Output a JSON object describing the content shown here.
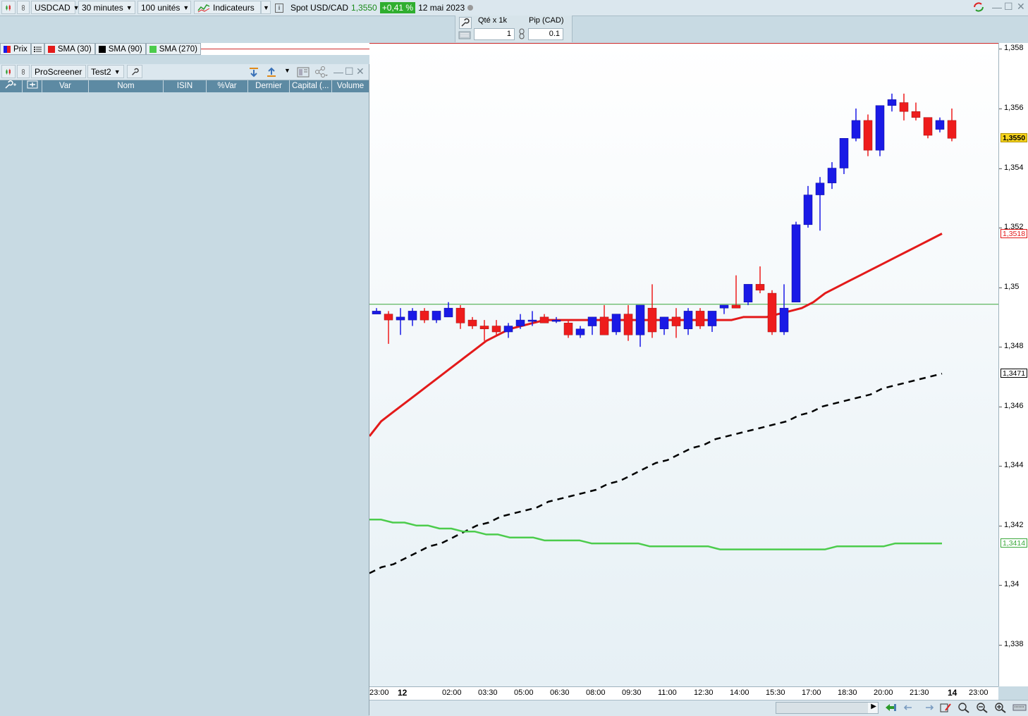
{
  "toolbar": {
    "symbol": "USDCAD",
    "timeframe": "30 minutes",
    "units": "100 unités",
    "indicators_label": "Indicateurs",
    "instrument": "Spot USD/CAD",
    "price": "1,3550",
    "change": "+0,41 %",
    "date": "12 mai 2023"
  },
  "order_panel": {
    "qty_label": "Qté x 1k",
    "pip_label": "Pip (CAD)",
    "qty_value": "1",
    "pip_value": "0.1"
  },
  "legend": {
    "price": "Prix",
    "sma30": "SMA (30)",
    "sma90": "SMA (90)",
    "sma270": "SMA (270)"
  },
  "screener": {
    "title": "ProScreener",
    "list": "Test2",
    "columns": [
      "Var",
      "Nom",
      "ISIN",
      "%Var",
      "Dernier",
      "Capital (...",
      "Volume"
    ]
  },
  "colors": {
    "up": "#1a1ae6",
    "down": "#ee1c1c",
    "sma30": "#e31a1a",
    "sma90": "#000000",
    "sma270": "#4ccc4c",
    "accent_change": "#2fae2f"
  },
  "chart_data": {
    "type": "candlestick",
    "y_ticks": [
      "1,358",
      "1,356",
      "1,354",
      "1,352",
      "1,35",
      "1,348",
      "1,346",
      "1,344",
      "1,342",
      "1,34",
      "1,338"
    ],
    "y_tick_values": [
      1.358,
      1.356,
      1.354,
      1.352,
      1.35,
      1.348,
      1.346,
      1.344,
      1.342,
      1.34,
      1.338
    ],
    "ylim": [
      1.3366,
      1.3582
    ],
    "x_ticks": [
      "23:00",
      "12",
      "02:00",
      "03:30",
      "05:00",
      "06:30",
      "08:00",
      "09:30",
      "11:00",
      "12:30",
      "14:00",
      "15:30",
      "17:00",
      "18:30",
      "20:00",
      "21:30",
      "14",
      "23:00"
    ],
    "price_tags": {
      "last": "1,3550",
      "sma30": "1,3518",
      "sma90": "1,3471",
      "sma270": "1,3414"
    },
    "horizontal_lines": [
      1.3582,
      1.34943
    ],
    "candles": [
      {
        "o": 1.3491,
        "h": 1.3493,
        "l": 1.3492,
        "c": 1.3492
      },
      {
        "o": 1.3491,
        "h": 1.3492,
        "l": 1.3481,
        "c": 1.3489
      },
      {
        "o": 1.3489,
        "h": 1.3493,
        "l": 1.3484,
        "c": 1.349
      },
      {
        "o": 1.3489,
        "h": 1.3493,
        "l": 1.3487,
        "c": 1.3492
      },
      {
        "o": 1.3492,
        "h": 1.3493,
        "l": 1.3488,
        "c": 1.3489
      },
      {
        "o": 1.3489,
        "h": 1.3492,
        "l": 1.3488,
        "c": 1.3492
      },
      {
        "o": 1.349,
        "h": 1.3495,
        "l": 1.349,
        "c": 1.3493
      },
      {
        "o": 1.3493,
        "h": 1.3494,
        "l": 1.3486,
        "c": 1.3488
      },
      {
        "o": 1.3489,
        "h": 1.349,
        "l": 1.3486,
        "c": 1.3487
      },
      {
        "o": 1.3487,
        "h": 1.3489,
        "l": 1.3482,
        "c": 1.3486
      },
      {
        "o": 1.3487,
        "h": 1.3489,
        "l": 1.3484,
        "c": 1.3485
      },
      {
        "o": 1.3485,
        "h": 1.3488,
        "l": 1.3483,
        "c": 1.3487
      },
      {
        "o": 1.3487,
        "h": 1.3491,
        "l": 1.3486,
        "c": 1.3489
      },
      {
        "o": 1.3489,
        "h": 1.3492,
        "l": 1.3487,
        "c": 1.3489
      },
      {
        "o": 1.349,
        "h": 1.3491,
        "l": 1.3488,
        "c": 1.3488
      },
      {
        "o": 1.3489,
        "h": 1.349,
        "l": 1.3488,
        "c": 1.3489
      },
      {
        "o": 1.3488,
        "h": 1.3489,
        "l": 1.3483,
        "c": 1.3484
      },
      {
        "o": 1.3484,
        "h": 1.3487,
        "l": 1.3483,
        "c": 1.3486
      },
      {
        "o": 1.3487,
        "h": 1.349,
        "l": 1.3484,
        "c": 1.349
      },
      {
        "o": 1.349,
        "h": 1.3494,
        "l": 1.3484,
        "c": 1.3484
      },
      {
        "o": 1.3485,
        "h": 1.3491,
        "l": 1.3484,
        "c": 1.3491
      },
      {
        "o": 1.3491,
        "h": 1.3494,
        "l": 1.3482,
        "c": 1.3484
      },
      {
        "o": 1.3484,
        "h": 1.3494,
        "l": 1.348,
        "c": 1.3494
      },
      {
        "o": 1.3493,
        "h": 1.3501,
        "l": 1.3483,
        "c": 1.3485
      },
      {
        "o": 1.3486,
        "h": 1.349,
        "l": 1.3484,
        "c": 1.349
      },
      {
        "o": 1.349,
        "h": 1.3493,
        "l": 1.3483,
        "c": 1.3487
      },
      {
        "o": 1.3486,
        "h": 1.3493,
        "l": 1.3484,
        "c": 1.3492
      },
      {
        "o": 1.3492,
        "h": 1.3493,
        "l": 1.3486,
        "c": 1.3487
      },
      {
        "o": 1.3487,
        "h": 1.3492,
        "l": 1.3485,
        "c": 1.3492
      },
      {
        "o": 1.3493,
        "h": 1.3494,
        "l": 1.3491,
        "c": 1.3494
      },
      {
        "o": 1.3494,
        "h": 1.3504,
        "l": 1.3493,
        "c": 1.3493
      },
      {
        "o": 1.3495,
        "h": 1.3501,
        "l": 1.3494,
        "c": 1.3501
      },
      {
        "o": 1.3501,
        "h": 1.3507,
        "l": 1.3498,
        "c": 1.3499
      },
      {
        "o": 1.3498,
        "h": 1.3499,
        "l": 1.3484,
        "c": 1.3485
      },
      {
        "o": 1.3485,
        "h": 1.3501,
        "l": 1.3484,
        "c": 1.3493
      },
      {
        "o": 1.3495,
        "h": 1.3522,
        "l": 1.3495,
        "c": 1.3521
      },
      {
        "o": 1.3521,
        "h": 1.3534,
        "l": 1.352,
        "c": 1.3531
      },
      {
        "o": 1.3531,
        "h": 1.3537,
        "l": 1.3519,
        "c": 1.3535
      },
      {
        "o": 1.3535,
        "h": 1.3542,
        "l": 1.3533,
        "c": 1.354
      },
      {
        "o": 1.354,
        "h": 1.355,
        "l": 1.3538,
        "c": 1.355
      },
      {
        "o": 1.355,
        "h": 1.356,
        "l": 1.3549,
        "c": 1.3556
      },
      {
        "o": 1.3556,
        "h": 1.3558,
        "l": 1.3544,
        "c": 1.3546
      },
      {
        "o": 1.3546,
        "h": 1.3561,
        "l": 1.3544,
        "c": 1.3561
      },
      {
        "o": 1.3561,
        "h": 1.3565,
        "l": 1.3559,
        "c": 1.3563
      },
      {
        "o": 1.3562,
        "h": 1.3565,
        "l": 1.3556,
        "c": 1.3559
      },
      {
        "o": 1.3559,
        "h": 1.3562,
        "l": 1.3556,
        "c": 1.3557
      },
      {
        "o": 1.3557,
        "h": 1.3557,
        "l": 1.355,
        "c": 1.3551
      },
      {
        "o": 1.3553,
        "h": 1.3557,
        "l": 1.3552,
        "c": 1.3556
      },
      {
        "o": 1.3556,
        "h": 1.356,
        "l": 1.3549,
        "c": 1.355
      }
    ],
    "series": [
      {
        "name": "SMA (30)",
        "style": "solid",
        "values": [
          1.345,
          1.3455,
          1.3458,
          1.3461,
          1.3464,
          1.3467,
          1.347,
          1.3473,
          1.3476,
          1.3479,
          1.3482,
          1.3484,
          1.3486,
          1.3487,
          1.3488,
          1.3489,
          1.3489,
          1.3489,
          1.3489,
          1.3489,
          1.3489,
          1.3489,
          1.3489,
          1.3489,
          1.3489,
          1.3489,
          1.3489,
          1.3489,
          1.3489,
          1.3489,
          1.3489,
          1.3489,
          1.349,
          1.349,
          1.349,
          1.3491,
          1.3492,
          1.3493,
          1.3495,
          1.3498,
          1.35,
          1.3502,
          1.3504,
          1.3506,
          1.3508,
          1.351,
          1.3512,
          1.3514,
          1.3516,
          1.3518
        ]
      },
      {
        "name": "SMA (90)",
        "style": "dashed",
        "values": [
          1.3404,
          1.3406,
          1.3407,
          1.3409,
          1.3411,
          1.3413,
          1.3414,
          1.3416,
          1.3418,
          1.342,
          1.3421,
          1.3423,
          1.3424,
          1.3425,
          1.3426,
          1.3428,
          1.3429,
          1.343,
          1.3431,
          1.3432,
          1.3434,
          1.3435,
          1.3437,
          1.3439,
          1.3441,
          1.3442,
          1.3444,
          1.3446,
          1.3447,
          1.3449,
          1.345,
          1.3451,
          1.3452,
          1.3453,
          1.3454,
          1.3455,
          1.3457,
          1.3458,
          1.346,
          1.3461,
          1.3462,
          1.3463,
          1.3464,
          1.3466,
          1.3467,
          1.3468,
          1.3469,
          1.347,
          1.3471
        ]
      },
      {
        "name": "SMA (270)",
        "style": "solid",
        "values": [
          1.3422,
          1.3422,
          1.3421,
          1.3421,
          1.342,
          1.342,
          1.3419,
          1.3419,
          1.3418,
          1.3418,
          1.3417,
          1.3417,
          1.3416,
          1.3416,
          1.3416,
          1.3415,
          1.3415,
          1.3415,
          1.3415,
          1.3414,
          1.3414,
          1.3414,
          1.3414,
          1.3414,
          1.3413,
          1.3413,
          1.3413,
          1.3413,
          1.3413,
          1.3413,
          1.3412,
          1.3412,
          1.3412,
          1.3412,
          1.3412,
          1.3412,
          1.3412,
          1.3412,
          1.3412,
          1.3412,
          1.3413,
          1.3413,
          1.3413,
          1.3413,
          1.3413,
          1.3414,
          1.3414,
          1.3414,
          1.3414,
          1.3414
        ]
      }
    ]
  }
}
